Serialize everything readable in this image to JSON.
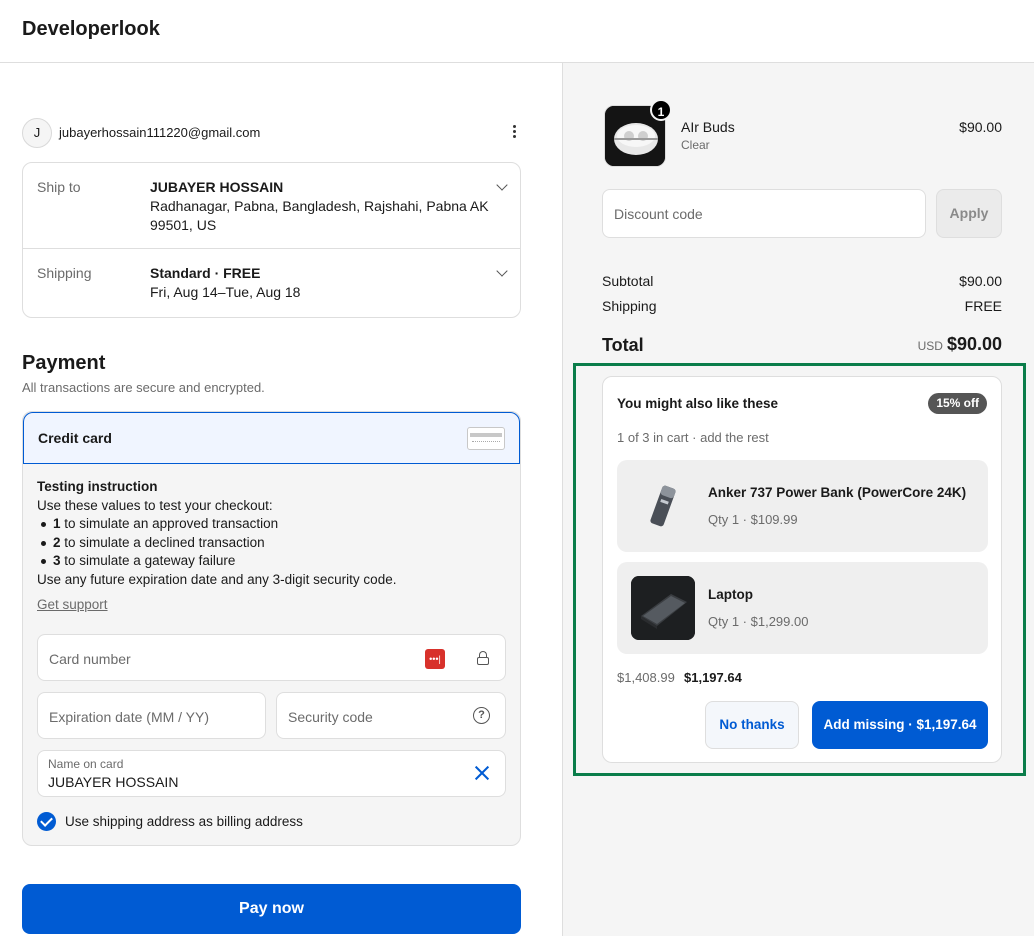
{
  "header": {
    "brand": "Developerlook"
  },
  "account": {
    "avatar_initial": "J",
    "email": "jubayerhossain111220@gmail.com",
    "menu_icon": "kebab-icon"
  },
  "review": {
    "ship_to": {
      "label": "Ship to",
      "name": "JUBAYER HOSSAIN",
      "address_line1": "Radhanagar, Pabna, Bangladesh, Rajshahi, Pabna AK",
      "address_line2": "99501, US"
    },
    "shipping": {
      "label": "Shipping",
      "method": "Standard · FREE",
      "dates": "Fri, Aug 14–Tue, Aug 18"
    }
  },
  "payment": {
    "title": "Payment",
    "subtitle": "All transactions are secure and encrypted.",
    "method_label": "Credit card",
    "instructions": {
      "title": "Testing instruction",
      "intro": "Use these values to test your checkout:",
      "items": [
        {
          "key": "1",
          "text": "to simulate an approved transaction"
        },
        {
          "key": "2",
          "text": "to simulate a declined transaction"
        },
        {
          "key": "3",
          "text": "to simulate a gateway failure"
        }
      ],
      "footer": "Use any future expiration date and any 3-digit security code.",
      "support_link": "Get support"
    },
    "card_number_placeholder": "Card number",
    "expiration_placeholder": "Expiration date (MM / YY)",
    "security_placeholder": "Security code",
    "name_label": "Name on card",
    "name_value": "JUBAYER HOSSAIN",
    "billing_checkbox_label": "Use shipping address as billing address",
    "billing_checked": true,
    "pay_button": "Pay now"
  },
  "summary": {
    "item": {
      "name": "AIr Buds",
      "variant": "Clear",
      "price": "$90.00",
      "quantity": "1"
    },
    "discount_placeholder": "Discount code",
    "apply_label": "Apply",
    "subtotal_label": "Subtotal",
    "subtotal_value": "$90.00",
    "shipping_label": "Shipping",
    "shipping_value": "FREE",
    "total_label": "Total",
    "total_currency": "USD",
    "total_value": "$90.00"
  },
  "upsell": {
    "title": "You might also like these",
    "badge": "15% off",
    "subtitle": "1 of 3 in cart · add the rest",
    "products": [
      {
        "name": "Anker 737 Power Bank (PowerCore 24K)",
        "meta": "Qty 1 · $109.99"
      },
      {
        "name": "Laptop",
        "meta": "Qty 1 · $1,299.00"
      }
    ],
    "original_price": "$1,408.99",
    "discounted_price": "$1,197.64",
    "decline_label": "No thanks",
    "accept_label": "Add missing · $1,197.64"
  },
  "colors": {
    "accent": "#005bd3",
    "highlight_frame": "#0a7d4a",
    "card_brand": "#d8312b"
  }
}
